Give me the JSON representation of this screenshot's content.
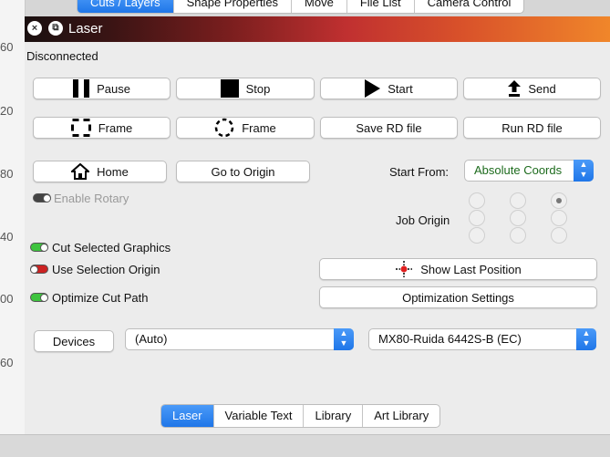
{
  "ruler": {
    "labels": [
      "60",
      "20",
      "80",
      "40",
      "00",
      "60"
    ]
  },
  "top_tabs": [
    "Cuts / Layers",
    "Shape Properties",
    "Move",
    "File List",
    "Camera Control"
  ],
  "window": {
    "title": "Laser",
    "close_icon": "×",
    "restore_icon": "⧉",
    "gradient_colors": [
      "#1a1010",
      "#c03030",
      "#f0862a"
    ]
  },
  "status": "Disconnected",
  "buttons": {
    "pause": "Pause",
    "stop": "Stop",
    "start": "Start",
    "send": "Send",
    "frame_rect": "Frame",
    "frame_circle": "Frame",
    "save_rd": "Save RD file",
    "run_rd": "Run RD file",
    "home": "Home",
    "go_to_origin": "Go to Origin",
    "show_last_position": "Show Last Position",
    "optimization_settings": "Optimization Settings",
    "devices": "Devices"
  },
  "start_from": {
    "label": "Start From:",
    "value": "Absolute Coords"
  },
  "job_origin": {
    "label": "Job Origin",
    "selected": "top-right"
  },
  "toggles": {
    "enable_rotary": {
      "label": "Enable Rotary",
      "state": "off"
    },
    "cut_selected_graphics": {
      "label": "Cut Selected Graphics",
      "state": "on"
    },
    "use_selection_origin": {
      "label": "Use Selection Origin",
      "state": "off"
    },
    "optimize_cut_path": {
      "label": "Optimize Cut Path",
      "state": "on"
    }
  },
  "selects": {
    "port": "(Auto)",
    "device": "MX80-Ruida 6442S-B (EC)"
  },
  "bottom_tabs": [
    "Laser",
    "Variable Text",
    "Library",
    "Art Library"
  ],
  "colors": {
    "accent": "#1f76e8",
    "toggle_on": "#3ec43e",
    "toggle_off_red": "#c22222"
  }
}
